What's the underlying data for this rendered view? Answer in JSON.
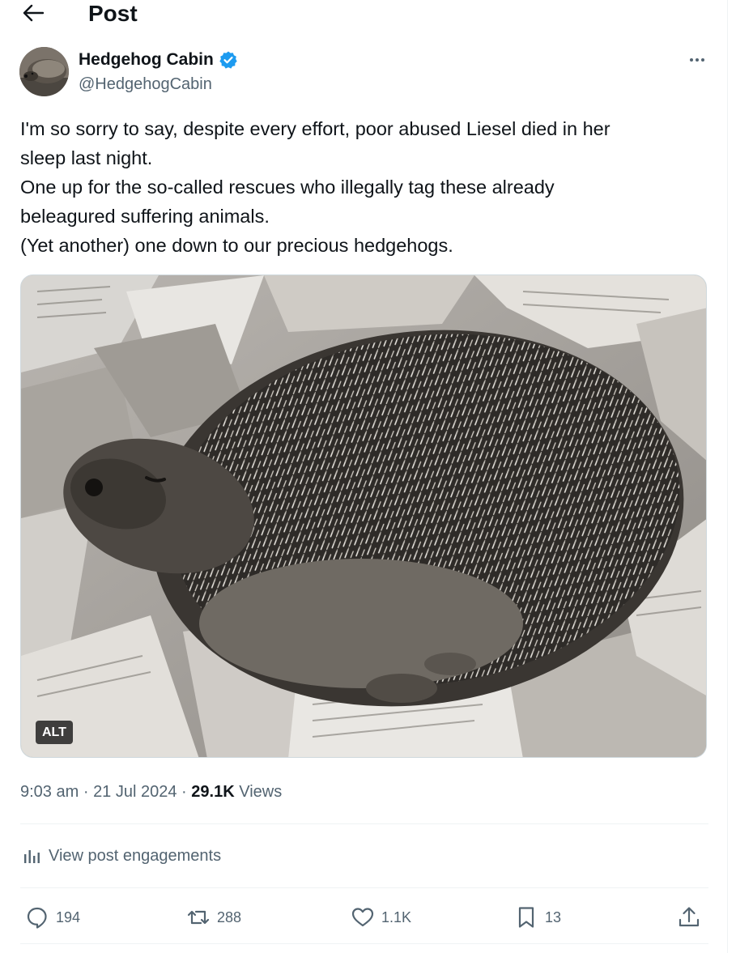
{
  "header": {
    "title": "Post",
    "back_icon": "arrow-left-icon"
  },
  "author": {
    "name": "Hedgehog Cabin",
    "handle": "@HedgehogCabin",
    "verified_color": "#1d9bf0"
  },
  "post": {
    "lines": [
      "I'm so sorry to say, despite every effort, poor abused Liesel died in her",
      "sleep last night.",
      "One up for the so-called rescues who illegally tag these already",
      "beleagured suffering animals.",
      "(Yet another) one down to our precious hedgehogs."
    ],
    "media_alt_badge": "ALT"
  },
  "meta": {
    "time": "9:03 am",
    "separator": "·",
    "date": "21 Jul 2024",
    "views_count": "29.1K",
    "views_label": "Views"
  },
  "engagements": {
    "label": "View post engagements"
  },
  "actions": {
    "reply_count": "194",
    "repost_count": "288",
    "like_count": "1.1K",
    "bookmark_count": "13"
  },
  "colors": {
    "text": "#0f1419",
    "secondary": "#536471",
    "divider": "#eff3f4",
    "accent": "#1d9bf0"
  }
}
